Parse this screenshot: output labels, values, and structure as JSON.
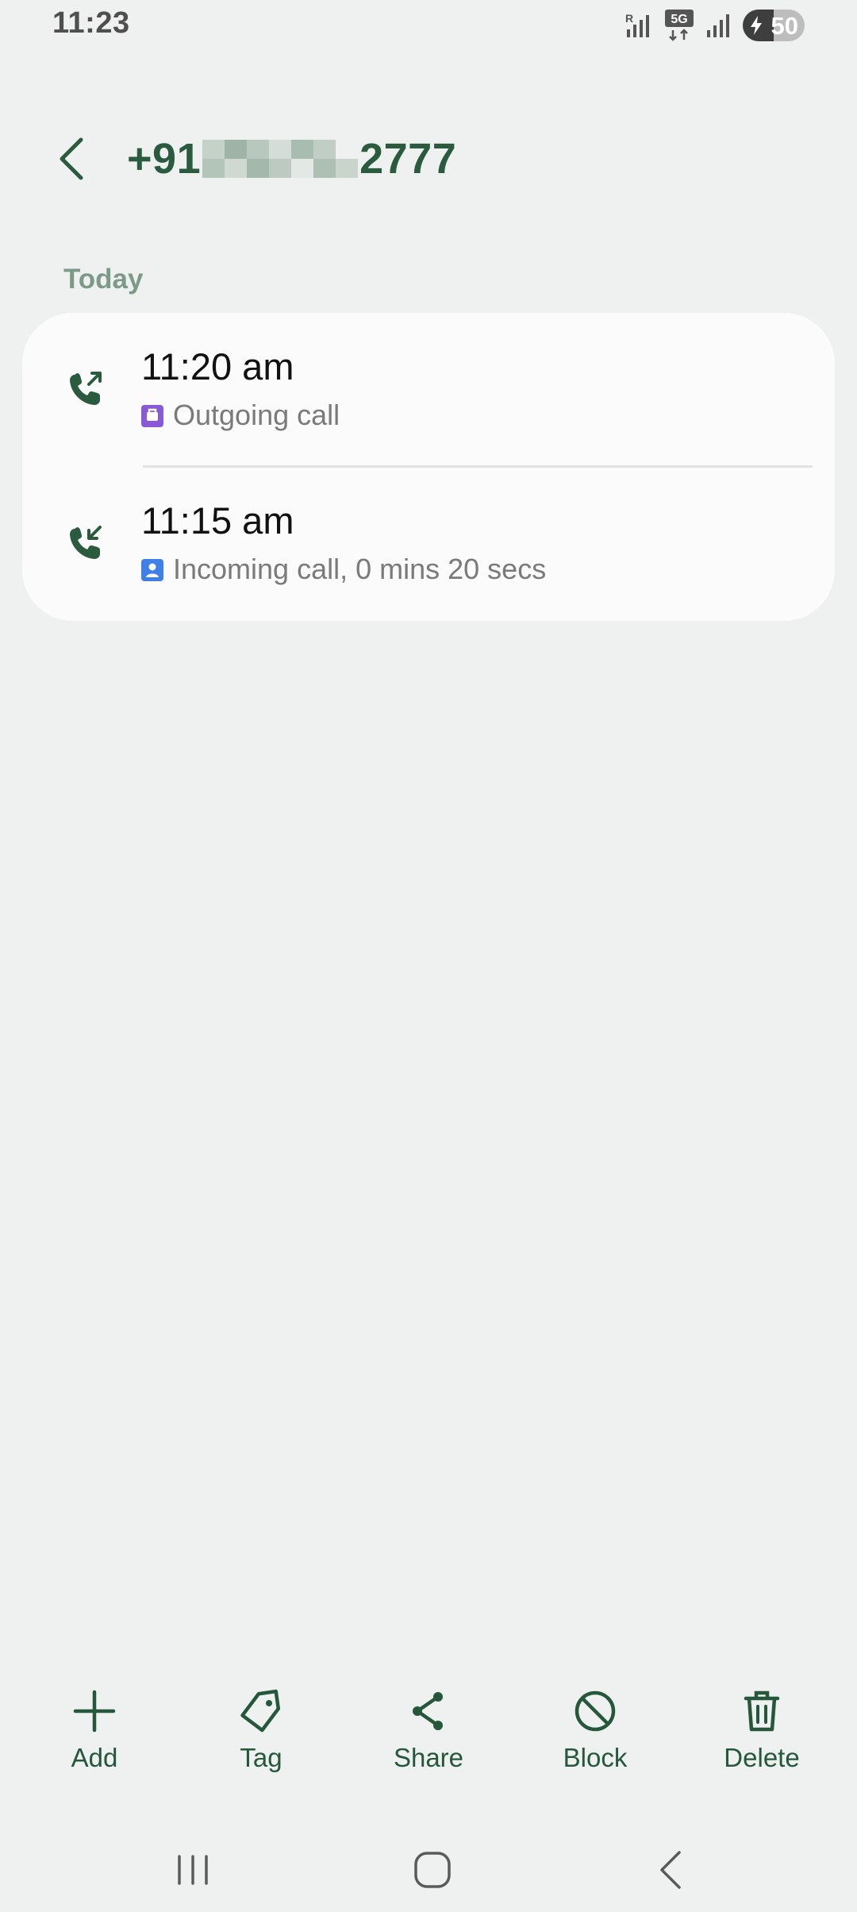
{
  "status_bar": {
    "time": "11:23",
    "network": "5G",
    "roaming": "R",
    "battery_level": "50",
    "battery_charging": true
  },
  "header": {
    "title_prefix": "+91",
    "title_suffix": "2777",
    "back_icon": "chevron-left-icon"
  },
  "call_log": {
    "section_label": "Today",
    "entries": [
      {
        "time": "11:20 am",
        "detail": "Outgoing call",
        "direction_icon": "outgoing-call-icon",
        "sim_icon": "sim-work-icon",
        "sim_color": "#8a5ad6"
      },
      {
        "time": "11:15 am",
        "detail": "Incoming call, 0 mins 20 secs",
        "direction_icon": "incoming-call-icon",
        "sim_icon": "sim-personal-icon",
        "sim_color": "#3f7fe8"
      }
    ]
  },
  "toolbar": {
    "add_label": "Add",
    "tag_label": "Tag",
    "share_label": "Share",
    "block_label": "Block",
    "delete_label": "Delete"
  },
  "theme": {
    "accent": "#2a5b3e",
    "background": "#eef1f0",
    "card": "#fbfbfb"
  }
}
